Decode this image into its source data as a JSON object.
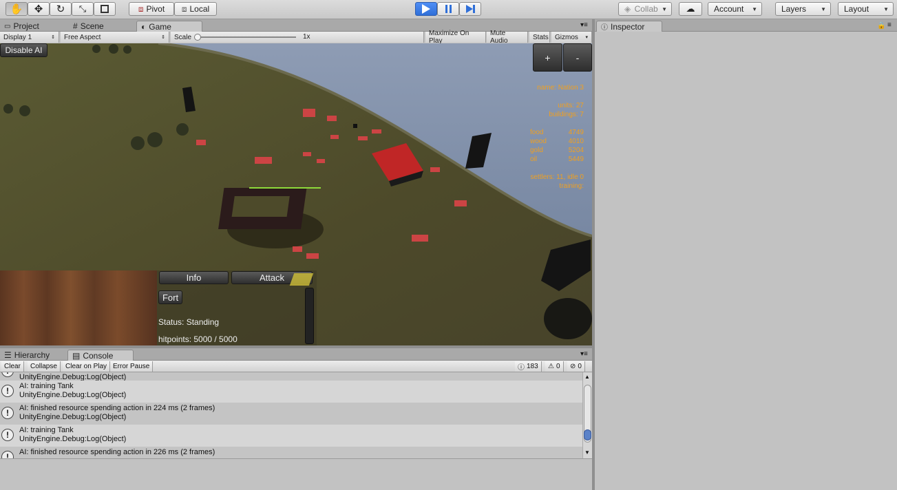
{
  "toolbar": {
    "pivot_label": "Pivot",
    "local_label": "Local",
    "collab_label": "Collab",
    "account_label": "Account",
    "layers_label": "Layers",
    "layout_label": "Layout"
  },
  "tabs": {
    "project": "Project",
    "scene": "Scene",
    "game": "Game",
    "inspector": "Inspector",
    "hierarchy": "Hierarchy",
    "console": "Console"
  },
  "game_controls": {
    "display": "Display 1",
    "aspect": "Free Aspect",
    "scale_label": "Scale",
    "scale_value": "1x",
    "maximize": "Maximize On Play",
    "mute": "Mute Audio",
    "stats": "Stats",
    "gizmos": "Gizmos"
  },
  "game": {
    "disable_ai": "Disable AI",
    "zoom_in": "+",
    "zoom_out": "-",
    "hud": {
      "name": "name: Nation 3",
      "units": "units: 27",
      "buildings": "buildings: 7",
      "resources": [
        {
          "label": "food",
          "value": "4749"
        },
        {
          "label": "wood",
          "value": "4010"
        },
        {
          "label": "gold",
          "value": "5204"
        },
        {
          "label": "oil",
          "value": "5449"
        }
      ],
      "settlers": "settlers: 11, idle 0",
      "training": "training:"
    },
    "panel": {
      "info_btn": "Info",
      "attack_btn": "Attack",
      "selected": "Fort",
      "status": "Status: Standing",
      "hitpoints": "hitpoints: 5000 / 5000"
    }
  },
  "console": {
    "buttons": [
      "Clear",
      "Collapse",
      "Clear on Play",
      "Error Pause"
    ],
    "counts": {
      "log": "183",
      "warn": "0",
      "error": "0"
    },
    "top_partial": "UnityEngine.Debug:Log(Object)",
    "rows": [
      {
        "line1": "AI: training Tank",
        "line2": "UnityEngine.Debug:Log(Object)"
      },
      {
        "line1": "AI: finished resource spending action in 224 ms (2 frames)",
        "line2": "UnityEngine.Debug:Log(Object)"
      },
      {
        "line1": "AI: training Tank",
        "line2": "UnityEngine.Debug:Log(Object)"
      },
      {
        "line1": "AI: finished resource spending action in 226 ms (2 frames)",
        "line2": ""
      }
    ]
  },
  "colors": {
    "play_accent": "#2f6fd8",
    "hud_text": "#f0a020",
    "editor_bg": "#c2c2c2"
  }
}
